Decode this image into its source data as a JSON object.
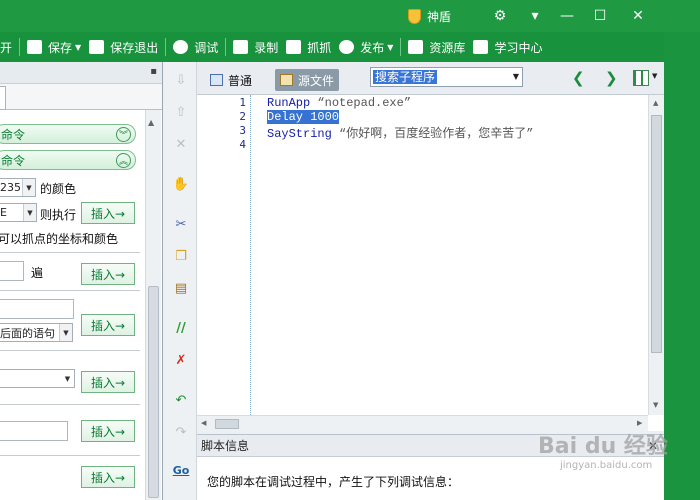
{
  "titlebar": {
    "shendun_label": "神盾",
    "colors": {
      "title_bg": "#1f9a43",
      "toolbar_bg": "#18923d"
    }
  },
  "toolbar": {
    "open_label": "开",
    "save_label": "保存",
    "save_exit_label": "保存退出",
    "debug_label": "调试",
    "record_label": "录制",
    "capture_label": "抓抓",
    "publish_label": "发布",
    "resource_label": "资源库",
    "learning_label": "学习中心"
  },
  "left_panel": {
    "cmd_bar_1": "命令",
    "cmd_bar_2": "命令",
    "color_combo_value": "235",
    "color_suffix": "的颜色",
    "cond_combo_value": "E",
    "then_exec": "则执行",
    "coord_hint": "可以抓点的坐标和颜色",
    "times_label": "遍",
    "stmt_combo_value": "后面的语句",
    "insert_label": "插入→"
  },
  "editor_toolbar": {
    "normal_mode": "普通",
    "source_mode": "源文件",
    "search_combo_value": "搜索子程序"
  },
  "code": {
    "lines": [
      {
        "num": "1",
        "cmd": "RunApp ",
        "arg": "“notepad.exe”"
      },
      {
        "num": "2",
        "cmd": "Delay 1000",
        "arg": ""
      },
      {
        "num": "3",
        "cmd": "SayString ",
        "arg": "“你好啊，百度经验作者，您辛苦了”"
      },
      {
        "num": "4",
        "cmd": "",
        "arg": ""
      }
    ]
  },
  "info_panel": {
    "title": "脚本信息",
    "message": "您的脚本在调试过程中，产生了下列调试信息："
  },
  "watermark": {
    "brand": "Bai du 经验",
    "url": "jingyan.baidu.com"
  }
}
